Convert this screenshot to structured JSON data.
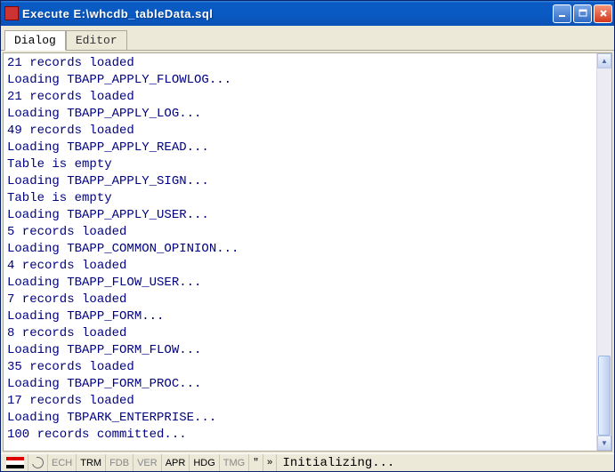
{
  "window": {
    "title": "Execute E:\\whcdb_tableData.sql"
  },
  "tabs": {
    "dialog": "Dialog",
    "editor": "Editor"
  },
  "log_lines": [
    "21 records loaded",
    "Loading TBAPP_APPLY_FLOWLOG...",
    "21 records loaded",
    "Loading TBAPP_APPLY_LOG...",
    "49 records loaded",
    "Loading TBAPP_APPLY_READ...",
    "Table is empty",
    "Loading TBAPP_APPLY_SIGN...",
    "Table is empty",
    "Loading TBAPP_APPLY_USER...",
    "5 records loaded",
    "Loading TBAPP_COMMON_OPINION...",
    "4 records loaded",
    "Loading TBAPP_FLOW_USER...",
    "7 records loaded",
    "Loading TBAPP_FORM...",
    "8 records loaded",
    "Loading TBAPP_FORM_FLOW...",
    "35 records loaded",
    "Loading TBAPP_FORM_PROC...",
    "17 records loaded",
    "Loading TBPARK_ENTERPRISE...",
    "100 records committed..."
  ],
  "status": {
    "panes": {
      "ech": "ECH",
      "trm": "TRM",
      "fdb": "FDB",
      "ver": "VER",
      "apr": "APR",
      "hdg": "HDG",
      "tmg": "TMG",
      "sep1": "\"",
      "sep2": "»"
    },
    "text": "Initializing..."
  }
}
